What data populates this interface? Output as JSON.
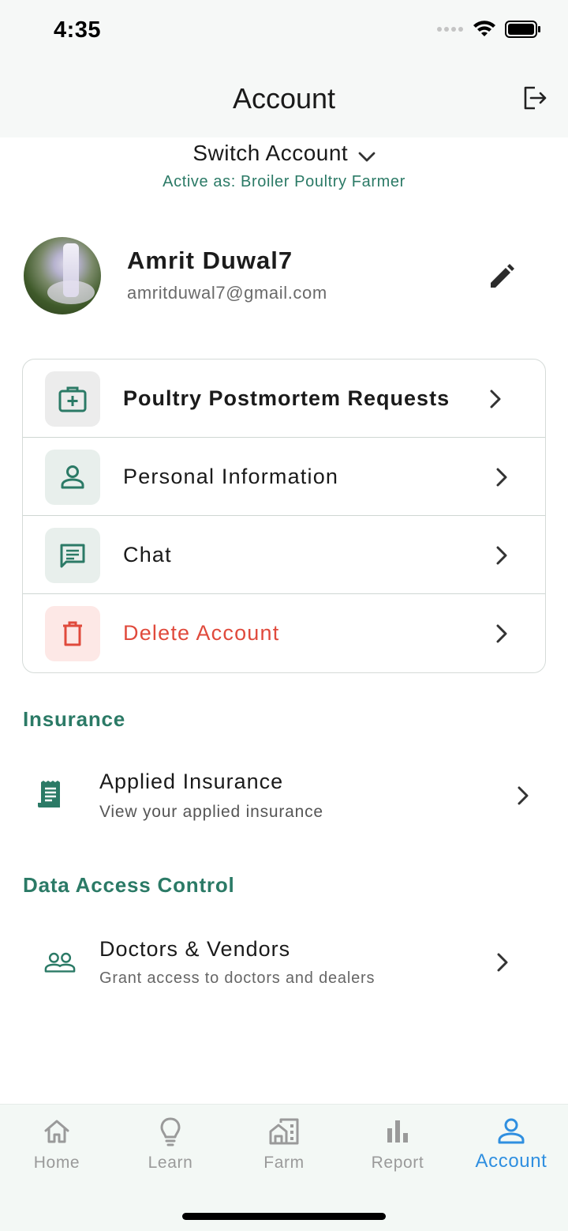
{
  "status_bar": {
    "time": "4:35"
  },
  "header": {
    "title": "Account"
  },
  "switch": {
    "label": "Switch Account",
    "active_as": "Active as: Broiler Poultry Farmer"
  },
  "profile": {
    "name": "Amrit Duwal7",
    "email": "amritduwal7@gmail.com"
  },
  "menu": {
    "items": [
      {
        "label": "Poultry Postmortem Requests",
        "icon": "medical-kit-icon"
      },
      {
        "label": "Personal Information",
        "icon": "person-icon"
      },
      {
        "label": "Chat",
        "icon": "chat-icon"
      },
      {
        "label": "Delete Account",
        "icon": "trash-icon"
      }
    ]
  },
  "insurance": {
    "section_title": "Insurance",
    "item": {
      "title": "Applied Insurance",
      "subtitle": "View your applied insurance",
      "icon": "receipt-icon"
    }
  },
  "data_access": {
    "section_title": "Data Access Control",
    "item": {
      "title": "Doctors & Vendors",
      "subtitle": "Grant access to doctors and dealers",
      "icon": "people-icon"
    }
  },
  "bottom_nav": {
    "items": [
      {
        "label": "Home",
        "icon": "home-icon"
      },
      {
        "label": "Learn",
        "icon": "lightbulb-icon"
      },
      {
        "label": "Farm",
        "icon": "farm-icon"
      },
      {
        "label": "Report",
        "icon": "bar-chart-icon"
      },
      {
        "label": "Account",
        "icon": "account-icon"
      }
    ],
    "active": "Account"
  },
  "colors": {
    "accent_green": "#2b7a66",
    "danger_red": "#e04a3c",
    "active_blue": "#2f8fe0"
  }
}
